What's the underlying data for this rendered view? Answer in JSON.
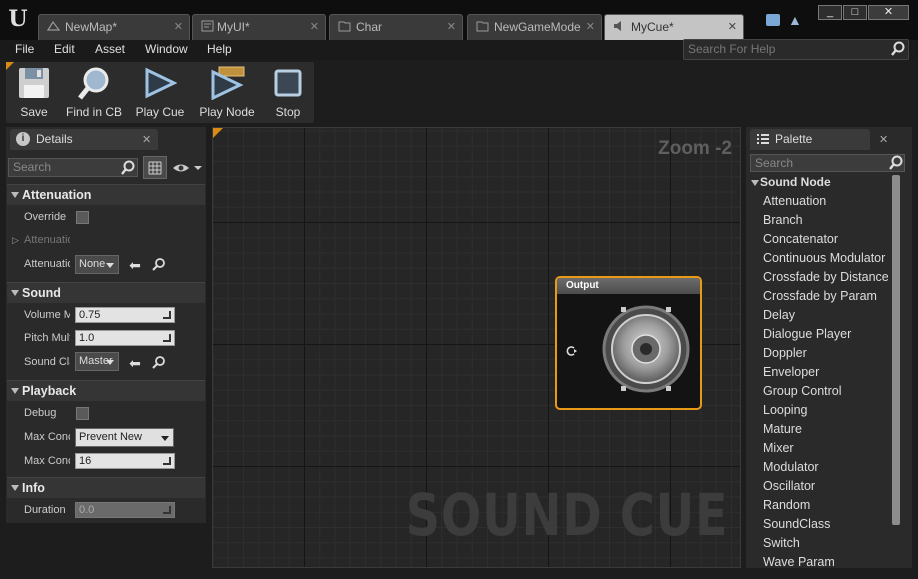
{
  "tabs": [
    {
      "label": "NewMap*",
      "icon": "level-icon",
      "active": false
    },
    {
      "label": "MyUI*",
      "icon": "widget-blueprint-icon",
      "active": false
    },
    {
      "label": "Char",
      "icon": "blueprint-icon",
      "active": false
    },
    {
      "label": "NewGameMode",
      "icon": "blueprint-icon",
      "active": false
    },
    {
      "label": "MyCue*",
      "icon": "sound-cue-icon",
      "active": true
    }
  ],
  "window_controls": {
    "minimize": "_",
    "maximize": "□",
    "close": "✕"
  },
  "menu": [
    "File",
    "Edit",
    "Asset",
    "Window",
    "Help"
  ],
  "help_search": {
    "placeholder": "Search For Help"
  },
  "toolbar": [
    {
      "label": "Save",
      "icon": "save-icon"
    },
    {
      "label": "Find in CB",
      "icon": "find-in-content-browser-icon"
    },
    {
      "label": "Play Cue",
      "icon": "play-cue-icon"
    },
    {
      "label": "Play Node",
      "icon": "play-node-icon"
    },
    {
      "label": "Stop",
      "icon": "stop-icon"
    }
  ],
  "details": {
    "tab_label": "Details",
    "search_placeholder": "Search",
    "sections": {
      "attenuation": {
        "title": "Attenuation",
        "override_label": "Override",
        "settings_label": "Attenuation Overrides",
        "asset_label": "Attenuation",
        "asset_value": "None"
      },
      "sound": {
        "title": "Sound",
        "volume_label": "Volume Multiplier",
        "volume_value": "0.75",
        "pitch_label": "Pitch Multiplier",
        "pitch_value": "1.0",
        "class_label": "Sound Class",
        "class_value": "Master"
      },
      "playback": {
        "title": "Playback",
        "debug_label": "Debug",
        "max_concurrent_rule_label": "Max Concurrent Resolution Rule",
        "max_concurrent_rule_value": "Prevent New",
        "max_concurrent_count_label": "Max Concurrent Play Count",
        "max_concurrent_count_value": "16"
      },
      "info": {
        "title": "Info",
        "duration_label": "Duration",
        "duration_value": "0.0"
      }
    }
  },
  "graph": {
    "zoom_label": "Zoom -2",
    "watermark": "SOUND CUE",
    "output_node_title": "Output"
  },
  "palette": {
    "tab_label": "Palette",
    "search_placeholder": "Search",
    "category": "Sound Node",
    "items": [
      "Attenuation",
      "Branch",
      "Concatenator",
      "Continuous Modulator",
      "Crossfade by Distance",
      "Crossfade by Param",
      "Delay",
      "Dialogue Player",
      "Doppler",
      "Enveloper",
      "Group Control",
      "Looping",
      "Mature",
      "Mixer",
      "Modulator",
      "Oscillator",
      "Random",
      "SoundClass",
      "Switch",
      "Wave Param"
    ]
  },
  "colors": {
    "accent": "#e89a17",
    "graph_bg": "#262626",
    "panel_bg": "#2a2a2a"
  }
}
